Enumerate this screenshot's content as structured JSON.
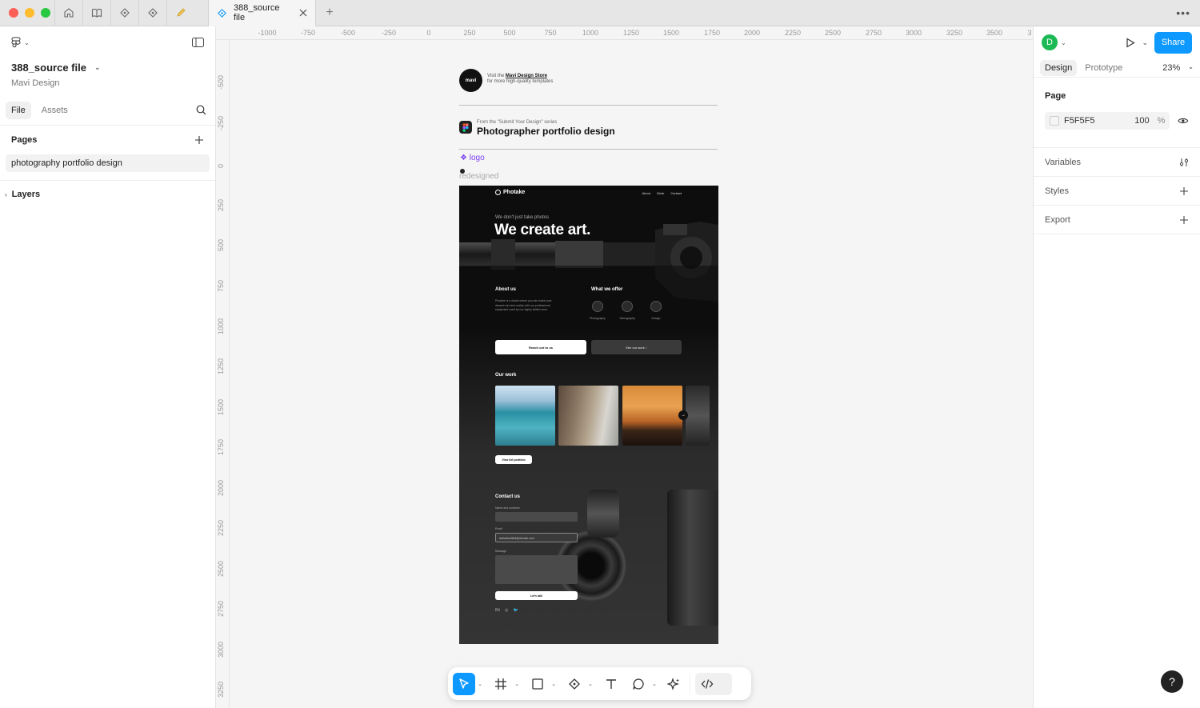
{
  "titlebar": {
    "tab_title": "388_source file",
    "new_tab": "+",
    "more": "•••"
  },
  "left_panel": {
    "file_name": "388_source file",
    "team": "Mavi Design",
    "tabs": [
      "File",
      "Assets"
    ],
    "pages_label": "Pages",
    "pages": [
      "photography portfolio design"
    ],
    "layers_label": "Layers"
  },
  "rulers": {
    "top": [
      "-1000",
      "-750",
      "-500",
      "-250",
      "0",
      "250",
      "500",
      "750",
      "1000",
      "1250",
      "1500",
      "1750",
      "2000",
      "2250",
      "2500",
      "2750",
      "3000",
      "3250",
      "3500",
      "3"
    ],
    "left": [
      "-500",
      "-250",
      "0",
      "250",
      "500",
      "750",
      "1000",
      "1250",
      "1500",
      "1750",
      "2000",
      "2250",
      "2500",
      "2750",
      "3000",
      "3250"
    ]
  },
  "canvas": {
    "mavi_logo": "mavi",
    "mavi_line1_prefix": "Visit the ",
    "mavi_store": "Mavi Design Store",
    "mavi_line2": "for more high-quality templates",
    "series_small": "From the \"Submit Your Design\" series",
    "series_title": "Photographer portfolio design",
    "component_logo": "❖ logo",
    "redesigned": "redesigned"
  },
  "design": {
    "brand": "Photake",
    "nav": [
      "About",
      "Work",
      "Contact"
    ],
    "hero_sub": "We don't just take photos",
    "hero_title": "We create art.",
    "about_title": "About us",
    "about_text": "Photake is a studio where you can make your dreams turn into reality with our professional equipment used by our highly skilled crew.",
    "offer_title": "What we offer",
    "services": [
      "Photography",
      "Videography",
      "Design"
    ],
    "btn_reach": "Reach out to us",
    "btn_work": "See our work  ↓",
    "work_title": "Our work",
    "btn_portfolio": "View full portfolio",
    "contact_title": "Contact us",
    "label_name": "Name and surname",
    "label_email": "Email",
    "email_value": "activationfield@domain.com",
    "label_message": "Message",
    "btn_talk": "Let's talk",
    "social": [
      "Bē",
      "◎",
      "🐦"
    ]
  },
  "right_panel": {
    "avatar": "D",
    "share": "Share",
    "tabs": [
      "Design",
      "Prototype"
    ],
    "zoom": "23%",
    "page_label": "Page",
    "page_color": "F5F5F5",
    "page_opacity": "100",
    "percent": "%",
    "sections": [
      "Variables",
      "Styles",
      "Export"
    ]
  },
  "help": "?"
}
